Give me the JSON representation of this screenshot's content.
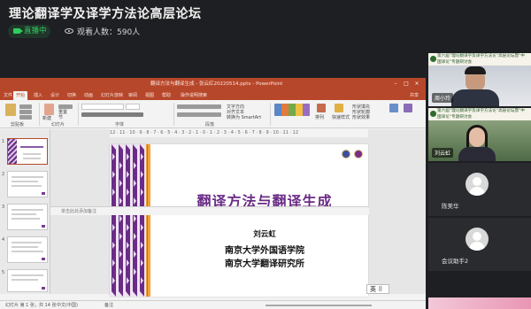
{
  "header": {
    "title": "理论翻译学及译学方法论高层论坛",
    "live_badge": "直播中",
    "viewers_label": "观看人数：590人"
  },
  "ppt": {
    "title_bar": "翻译方法与翻译生成 - 张云红20220514.pptx - PowerPoint",
    "tabs": [
      "文件",
      "开始",
      "插入",
      "设计",
      "切换",
      "动画",
      "幻灯片放映",
      "审阅",
      "视图",
      "帮助",
      "操作说明搜索"
    ],
    "share": "共享",
    "ribbon_groups": [
      "剪贴板",
      "幻灯片",
      "字体",
      "段落"
    ],
    "ribbon_texts": [
      "新建",
      "幻灯片",
      "重置",
      "节",
      "文字方向",
      "对齐文本",
      "转换为 SmartArt",
      "排列",
      "快速样式",
      "形状填充",
      "形状轮廓",
      "形状效果"
    ],
    "ruler": "12 · 11 · 10 · 9 · 8 · 7 · 6 · 5 · 4 · 3 · 2 · 1 · 0 · 1 · 2 · 3 · 4 · 5 · 6 · 7 · 8 · 9 · 10 · 11 · 12",
    "slide": {
      "title": "翻译方法与翻译生成",
      "author": "刘云虹",
      "affiliation1": "南京大学外国语学院",
      "affiliation2": "南京大学翻译研究所"
    },
    "notes_placeholder": "单击此处添加备注",
    "input_lang": "英",
    "status": {
      "slide_count": "幻灯片 第 1 张，共 14 张",
      "language": "中文(中国)",
      "notes_btn": "备注"
    },
    "thumb_numbers": [
      "1",
      "2",
      "3",
      "4",
      "5"
    ]
  },
  "participants": [
    {
      "name": "周小玲",
      "type": "video",
      "banner": "第六届“理论翻译学及译学方法论”高层论坛暨“中国译论”专题研讨会"
    },
    {
      "name": "刘云虹",
      "type": "video",
      "banner": "第六届“理论翻译学及译学方法论”高层论坛暨“中国译论”专题研讨会"
    },
    {
      "name": "陈美华",
      "type": "avatar"
    },
    {
      "name": "会议助手2",
      "type": "avatar"
    }
  ],
  "colors": {
    "ppt_accent": "#b7472a",
    "slide_title": "#6a2c86",
    "live_green": "#2fce5c"
  }
}
